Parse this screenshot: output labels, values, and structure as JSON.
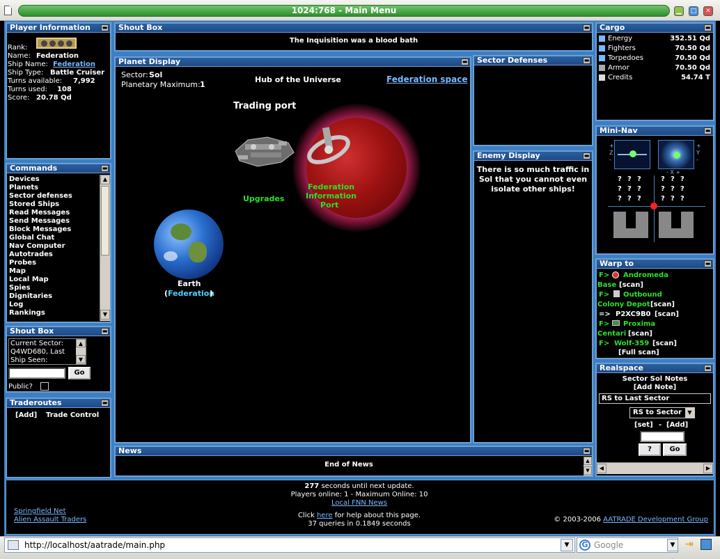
{
  "window": {
    "title": "1024:768 - Main Menu"
  },
  "player_info": {
    "title": "Player Information",
    "rank_label": "Rank:",
    "name_label": "Name:",
    "name": "Federation",
    "ship_name_label": "Ship Name:",
    "ship_name": "Federation",
    "ship_type_label": "Ship Type:",
    "ship_type": "Battle Cruiser",
    "turns_available_label": "Turns available:",
    "turns_available": "7,992",
    "turns_used_label": "Turns used:",
    "turns_used": "108",
    "score_label": "Score:",
    "score": "20.78 Qd"
  },
  "shout_top": {
    "title": "Shout Box",
    "message": "The Inquisition was a blood bath"
  },
  "commands": {
    "title": "Commands",
    "items": [
      "Devices",
      "Planets",
      "Sector defenses",
      "Stored Ships",
      "Read Messages",
      "Send Messages",
      "Block Messages",
      "Global Chat",
      "Nav Computer",
      "Autotrades",
      "Probes",
      "Map",
      "Local Map",
      "Spies",
      "Dignitaries",
      "Log",
      "Rankings"
    ]
  },
  "shout_left": {
    "title": "Shout Box",
    "text_line1": "Current Sector:",
    "text_line2": "Q4WD680, Last",
    "text_line3": "Ship Seen:",
    "go": "Go",
    "public_label": "Public?"
  },
  "traderoutes": {
    "title": "Traderoutes",
    "add": "[Add]",
    "control": "Trade Control"
  },
  "planet_display": {
    "title": "Planet Display",
    "sector_label": "Sector:",
    "sector": "Sol",
    "planetary_max_label": "Planetary Maximum:",
    "planetary_max": "1",
    "hub": "Hub of the Universe",
    "federation_space": "Federation space",
    "trading_port": "Trading port",
    "upgrades": "Upgrades",
    "fed_info_1": "Federation",
    "fed_info_2": "Information",
    "fed_info_3": "Port",
    "earth": "Earth",
    "earth_owner": "Federation",
    "paren_open": "(",
    "paren_close": ")"
  },
  "sector_defenses": {
    "title": "Sector Defenses"
  },
  "enemy_display": {
    "title": "Enemy Display",
    "line1": "There is so much traffic in",
    "line2": "Sol that you cannot even",
    "line3": "isolate other ships!"
  },
  "news": {
    "title": "News",
    "text": "End of News"
  },
  "cargo": {
    "title": "Cargo",
    "rows": [
      {
        "label": "Energy",
        "value": "352.51 Qd",
        "icon": "energy-icon"
      },
      {
        "label": "Fighters",
        "value": "70.50 Qd",
        "icon": "fighters-icon"
      },
      {
        "label": "Torpedoes",
        "value": "70.50 Qd",
        "icon": "torpedoes-icon"
      },
      {
        "label": "Armor",
        "value": "70.50 Qd",
        "icon": "armor-icon"
      },
      {
        "label": "Credits",
        "value": "54.74 T",
        "icon": "credits-icon"
      }
    ]
  },
  "mininav": {
    "title": "Mini-Nav",
    "q": "?",
    "axis_z": "Z",
    "axis_x": "X",
    "axis_y": "Y",
    "minus_x_plus": "- X +",
    "plus": "+",
    "minus": "-"
  },
  "warp": {
    "title": "Warp to",
    "prefix": "F>",
    "arrow": "=>",
    "scan": "[scan]",
    "full_scan": "[Full scan]",
    "dest1a": "Andromeda",
    "dest1b": "Base",
    "dest2a": "Outbound",
    "dest2b": "Colony Depot",
    "dest3": "P2XC9B0",
    "dest4a": "Proxima",
    "dest4b": "Centari",
    "dest5": "Wolf-359"
  },
  "realspace": {
    "title": "Realspace",
    "notes": "Sector Sol Notes",
    "add_note": "[Add Note]",
    "rs_last": "RS to Last Sector",
    "rs_sector": "RS to Sector",
    "set": "[set]",
    "dash": "-",
    "add": "[Add]",
    "q_btn": "?",
    "go": "Go"
  },
  "footer": {
    "seconds": "277",
    "seconds_text": "seconds until next update.",
    "players": "Players online: 1 - Maximum Online: 10",
    "fnn": "Local FNN News",
    "springfield": "Springfield Net",
    "aat": "Alien Assault Traders",
    "click": "Click",
    "here": "here",
    "help": "for help about this page.",
    "queries": "37 queries in 0.1849 seconds",
    "copyright": "© 2003-2006",
    "group": "AATRADE Development Group"
  },
  "browser": {
    "url": "http://localhost/aatrade/main.php",
    "search_placeholder": "Google"
  }
}
